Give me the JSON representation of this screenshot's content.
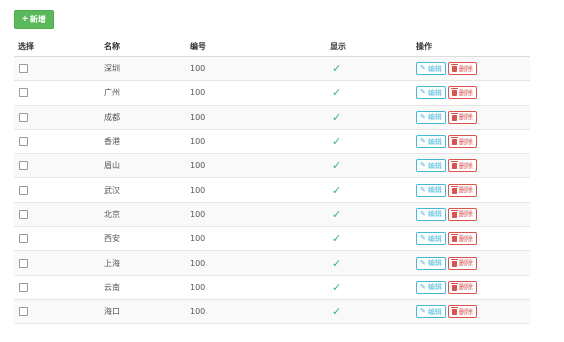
{
  "toolbar": {
    "add_icon": "plus-icon",
    "add_label": "新增"
  },
  "table": {
    "headers": {
      "select": "选择",
      "name": "名称",
      "code": "编号",
      "display": "显示",
      "actions": "操作"
    },
    "rows": [
      {
        "name": "深圳",
        "code": "100",
        "display": "✓"
      },
      {
        "name": "广州",
        "code": "100",
        "display": "✓"
      },
      {
        "name": "成都",
        "code": "100",
        "display": "✓"
      },
      {
        "name": "香港",
        "code": "100",
        "display": "✓"
      },
      {
        "name": "眉山",
        "code": "100",
        "display": "✓"
      },
      {
        "name": "武汉",
        "code": "100",
        "display": "✓"
      },
      {
        "name": "北京",
        "code": "100",
        "display": "✓"
      },
      {
        "name": "西安",
        "code": "100",
        "display": "✓"
      },
      {
        "name": "上海",
        "code": "100",
        "display": "✓"
      },
      {
        "name": "云南",
        "code": "100",
        "display": "✓"
      },
      {
        "name": "海口",
        "code": "100",
        "display": "✓"
      }
    ],
    "actions": {
      "edit_label": "编辑",
      "edit_icon": "pencil-icon",
      "delete_label": "删除",
      "delete_icon": "trash-icon"
    }
  },
  "colors": {
    "add_button": "#5cb85c",
    "edit_button": "#46b8da",
    "delete_button": "#d9534f",
    "check_mark": "#3cb371"
  }
}
